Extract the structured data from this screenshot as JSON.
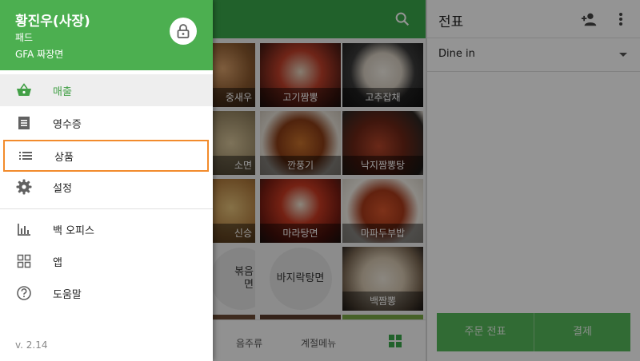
{
  "drawer": {
    "owner_name": "황진우(사장)",
    "device_name": "패드",
    "store_name": "GFA 짜장면",
    "lock_icon": "lock-icon",
    "nav_items": [
      {
        "label": "매출",
        "icon": "basket-icon",
        "active": true
      },
      {
        "label": "영수증",
        "icon": "receipt-icon"
      },
      {
        "label": "상품",
        "icon": "list-icon",
        "focused": true
      },
      {
        "label": "설정",
        "icon": "gear-icon"
      },
      {
        "label": "백 오피스",
        "icon": "bar-chart-icon"
      },
      {
        "label": "앱",
        "icon": "puzzle-icon"
      },
      {
        "label": "도움말",
        "icon": "help-icon"
      }
    ],
    "version": "v. 2.14",
    "accent_color": "#4caf50",
    "active_text_color": "#43a047",
    "focus_outline_color": "#f28b2c"
  },
  "items_grid": {
    "search_icon": "search-icon",
    "tiles": [
      {
        "caption": "중새우"
      },
      {
        "caption": "고기짬뽕"
      },
      {
        "caption": "고추잡채"
      },
      {
        "caption": "소면"
      },
      {
        "caption": "깐풍기"
      },
      {
        "caption": "낙지짬뽕탕"
      },
      {
        "caption": "신승"
      },
      {
        "caption": "마라탕면"
      },
      {
        "caption": "마파두부밥"
      },
      {
        "caption": "볶음\n면"
      },
      {
        "caption": "바지락탕면"
      },
      {
        "caption": "백짬뽕"
      }
    ],
    "bottom_tabs": [
      "음주류",
      "계절메뉴"
    ],
    "grid_view_icon": "grid-icon"
  },
  "ticket": {
    "title": "전표",
    "add_customer_icon": "add-person-icon",
    "more_icon": "more-vert-icon",
    "dining_option": "Dine in",
    "save_label": "주문 전표",
    "charge_label": "결제"
  }
}
